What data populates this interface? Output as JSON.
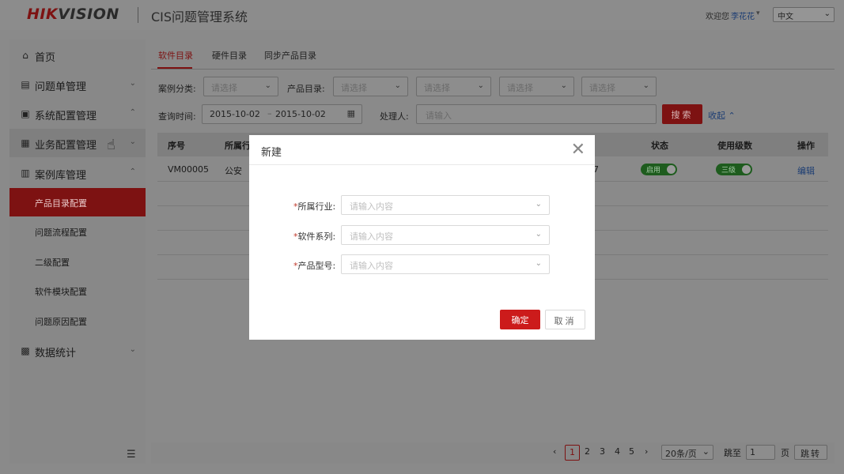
{
  "header": {
    "logo_hik": "HIK",
    "logo_vision": "VISION",
    "app_title": "CIS问题管理系统",
    "welcome": "欢迎您",
    "user_name": "李花花",
    "user_caret": "▾",
    "language": "中文",
    "language_caret": "⌄"
  },
  "sidebar": {
    "items": [
      {
        "label": "首页",
        "icon": "home-icon",
        "glyph": "⌂",
        "chevron": ""
      },
      {
        "label": "问题单管理",
        "icon": "issue-icon",
        "glyph": "▤",
        "chevron": "⌄"
      },
      {
        "label": "系统配置管理",
        "icon": "system-config-icon",
        "glyph": "▣",
        "chevron": "⌃"
      },
      {
        "label": "业务配置管理",
        "icon": "business-config-icon",
        "glyph": "▦",
        "chevron": "⌄"
      },
      {
        "label": "案例库管理",
        "icon": "case-library-icon",
        "glyph": "▥",
        "chevron": "⌃"
      }
    ],
    "sub_items": [
      "产品目录配置",
      "问题流程配置",
      "二级配置",
      "软件模块配置",
      "问题原因配置"
    ],
    "stats": {
      "label": "数据统计",
      "icon": "stats-icon",
      "glyph": "▩",
      "chevron": "⌄"
    },
    "collapse_glyph": "☰",
    "cursor_glyph": "☝"
  },
  "main": {
    "tabs": [
      "软件目录",
      "硬件目录",
      "同步产品目录"
    ],
    "filters": {
      "case_category_label": "案例分类:",
      "product_catalog_label": "产品目录:",
      "placeholder": "请选择",
      "chevron": "⌄",
      "query_time_label": "查询时间:",
      "date_start": "2015-10-02",
      "date_sep": "–",
      "date_end": "2015-10-02",
      "calendar_glyph": "▦",
      "handler_label": "处理人:",
      "handler_placeholder": "请输入",
      "search_button": "搜索",
      "collapse_link": "收起 ⌃"
    },
    "table": {
      "headers": [
        "序号",
        "所属行",
        "状态",
        "使用级数",
        "操作"
      ],
      "row": {
        "id": "VM00005",
        "industry": "公安",
        "partial": "7",
        "status": "启用",
        "level": "三级",
        "action": "编辑"
      }
    }
  },
  "pagination": {
    "prev": "‹",
    "pages": [
      "1",
      "2",
      "3",
      "4",
      "5"
    ],
    "next": "›",
    "page_size": "20条/页",
    "page_size_caret": "⌄",
    "goto_label": "跳至",
    "goto_value": "1",
    "page_unit": "页",
    "jump_button": "跳转"
  },
  "modal": {
    "title": "新建",
    "close_glyph": "✕",
    "fields": [
      {
        "label": "所属行业:",
        "placeholder": "请输入内容"
      },
      {
        "label": "软件系列:",
        "placeholder": "请输入内容"
      },
      {
        "label": "产品型号:",
        "placeholder": "请输入内容"
      }
    ],
    "required_mark": "*",
    "chevron": "⌄",
    "ok_button": "确定",
    "cancel_button": "取消"
  },
  "colors": {
    "brand_red": "#cc1b1b",
    "link_blue": "#1c3d73",
    "toggle_green": "#1e5c1e"
  }
}
